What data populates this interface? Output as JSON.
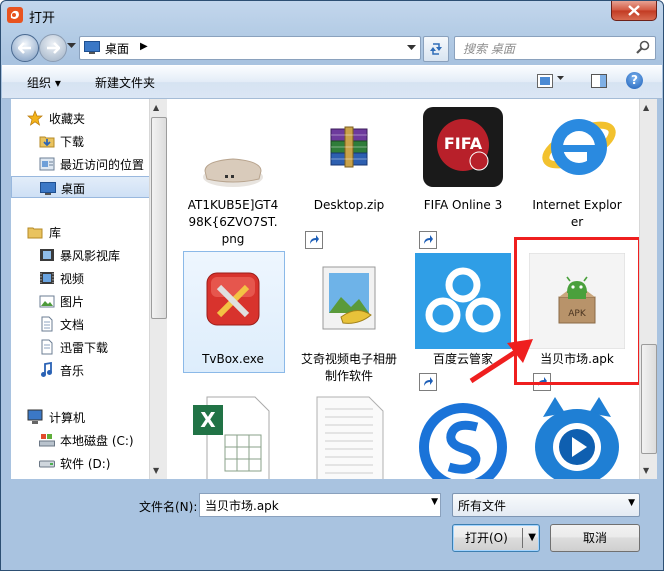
{
  "window": {
    "title": "打开"
  },
  "nav": {
    "address_text": "桌面",
    "search_placeholder": "搜索 桌面"
  },
  "toolbar": {
    "organize": "组织 ▾",
    "new_folder": "新建文件夹",
    "help": "?"
  },
  "sidebar": {
    "favorites": [
      {
        "label": "收藏夹",
        "icon": "star-icon"
      },
      {
        "label": "下载",
        "icon": "download-folder-icon"
      },
      {
        "label": "最近访问的位置",
        "icon": "recent-places-icon"
      },
      {
        "label": "桌面",
        "icon": "desktop-icon",
        "selected": true
      }
    ],
    "libraries": [
      {
        "label": "库",
        "icon": "library-icon"
      },
      {
        "label": "暴风影视库",
        "icon": "video-library-icon"
      },
      {
        "label": "视频",
        "icon": "video-icon"
      },
      {
        "label": "图片",
        "icon": "picture-icon"
      },
      {
        "label": "文档",
        "icon": "document-icon"
      },
      {
        "label": "迅雷下载",
        "icon": "thunder-download-icon"
      },
      {
        "label": "音乐",
        "icon": "music-icon"
      }
    ],
    "computer": [
      {
        "label": "计算机",
        "icon": "computer-icon"
      },
      {
        "label": "本地磁盘 (C:)",
        "icon": "local-disk-icon"
      },
      {
        "label": "软件 (D:)",
        "icon": "disk-icon"
      }
    ]
  },
  "files": [
    {
      "name": "AT1KUB5E]GT498K{6ZVO7ST.png",
      "icon": "router-image-icon"
    },
    {
      "name": "Desktop.zip",
      "icon": "winrar-archive-icon"
    },
    {
      "name": "FIFA Online 3",
      "icon": "fifa-online-icon",
      "shortcut": true
    },
    {
      "name": "Internet Explorer",
      "icon": "internet-explorer-icon",
      "shortcut": true
    },
    {
      "name": "TvBox.exe",
      "icon": "tvbox-icon",
      "selected": true
    },
    {
      "name": "艾奇视频电子相册制作软件",
      "icon": "photo-album-maker-icon",
      "shortcut": true
    },
    {
      "name": "百度云管家",
      "icon": "baidu-cloud-icon",
      "shortcut": true
    },
    {
      "name": "当贝市场.apk",
      "icon": "apk-package-icon"
    },
    {
      "name": "",
      "icon": "excel-file-icon"
    },
    {
      "name": "",
      "icon": "text-file-icon"
    },
    {
      "name": "",
      "icon": "sogou-browser-icon",
      "shortcut": true
    },
    {
      "name": "",
      "icon": "video-player-icon",
      "shortcut": true
    }
  ],
  "apk_label": "APK",
  "fifa_label": "FIFA",
  "bottom": {
    "filename_label": "文件名(N):",
    "filename_value": "当贝市场.apk",
    "filetype_value": "所有文件",
    "open_button": "打开(O)",
    "cancel_button": "取消"
  },
  "colors": {
    "highlight": "#ef1f1f",
    "arrow": "#ef1f1f",
    "selection": "#cfe0f5"
  }
}
